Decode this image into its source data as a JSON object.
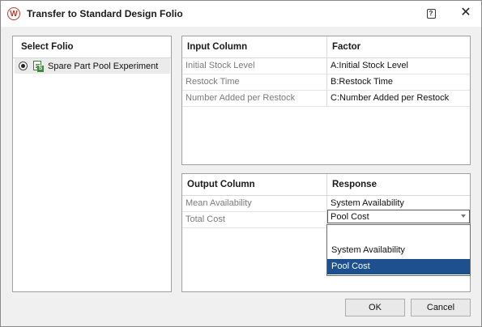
{
  "window": {
    "title": "Transfer to Standard Design Folio",
    "app_icon_letter": "W",
    "help_glyph": "?",
    "close_glyph": "✕"
  },
  "folio_panel": {
    "header": "Select Folio",
    "items": [
      {
        "label": "Spare Part Pool Experiment",
        "selected": true,
        "icon": "design-folio-icon"
      }
    ]
  },
  "input_grid": {
    "headers": [
      "Input Column",
      "Factor"
    ],
    "rows": [
      [
        "Initial Stock Level",
        "A:Initial Stock Level"
      ],
      [
        "Restock Time",
        "B:Restock Time"
      ],
      [
        "Number Added per Restock",
        "C:Number Added per Restock"
      ]
    ]
  },
  "output_grid": {
    "headers": [
      "Output Column",
      "Response"
    ],
    "rows": [
      [
        "Mean Availability",
        "System Availability"
      ],
      [
        "Total Cost",
        "Pool Cost"
      ]
    ]
  },
  "response_dropdown": {
    "value": "Pool Cost",
    "options": [
      "",
      "System Availability",
      "Pool Cost"
    ],
    "highlighted": "Pool Cost"
  },
  "buttons": {
    "ok": "OK",
    "cancel": "Cancel"
  },
  "colors": {
    "accent_selection": "#1e4f8f",
    "app_icon": "#c0392b"
  }
}
